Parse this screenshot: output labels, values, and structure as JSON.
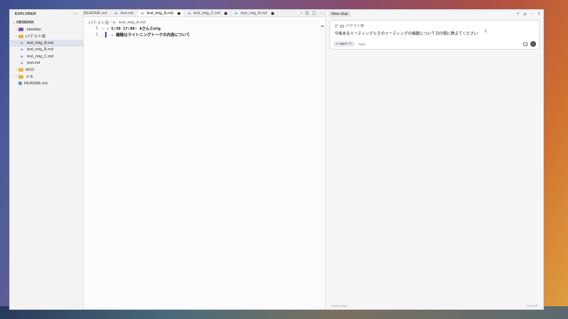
{
  "sidebar": {
    "title": "EXPLORER",
    "more": "···",
    "section": "OBSIDIAN",
    "items": [
      {
        "label": ".obsidian",
        "kind": "folder",
        "indent": 1,
        "chevron": "›",
        "color": "#7b4fc7"
      },
      {
        "label": "LTテスト用",
        "kind": "folder-open",
        "indent": 1,
        "chevron": "⌄",
        "color": "#e3b341"
      },
      {
        "label": "test_mtg_A.md",
        "kind": "md",
        "indent": 2,
        "selected": true
      },
      {
        "label": "test_mtg_B.md",
        "kind": "md",
        "indent": 2
      },
      {
        "label": "test_mtg_C.md",
        "kind": "md",
        "indent": 2
      },
      {
        "label": "test.md",
        "kind": "md",
        "indent": 2
      },
      {
        "label": "MOC",
        "kind": "folder",
        "indent": 1,
        "chevron": "›",
        "color": "#e3b341"
      },
      {
        "label": "メモ",
        "kind": "folder",
        "indent": 1,
        "chevron": "›",
        "color": "#e3b341"
      },
      {
        "label": "README.md",
        "kind": "info",
        "indent": 1
      }
    ]
  },
  "editor": {
    "tabs": [
      {
        "label": "README.md",
        "icon": "",
        "active": false,
        "dirty": false
      },
      {
        "label": "test.md",
        "icon": "M↓",
        "active": false,
        "dirty": false
      },
      {
        "label": "test_mtg_A.md",
        "icon": "M↓",
        "active": true,
        "dirty": true
      },
      {
        "label": "test_mtg_C.md",
        "icon": "M↓",
        "active": false,
        "dirty": true
      },
      {
        "label": "test_mtg_B.md",
        "icon": "M↓",
        "active": false,
        "dirty": true
      }
    ],
    "tab_overflow": "›",
    "breadcrumb": [
      "LTテスト用",
      "test_mtg_A.md"
    ],
    "lines": [
      {
        "num": "1",
        "text": "- 5/30 17:00~ Aさんとmtg",
        "fold": "⌄"
      },
      {
        "num": "2",
        "text": "  - 議題はライトニングトークの内容について",
        "fold": ""
      }
    ]
  },
  "chat": {
    "tab_label": "New chat",
    "context_label": "LTテスト用",
    "prompt": "今後あるミーティングとそのミーティングの議題について日付順に教えてください",
    "mode": "Agent",
    "mode_shortcut": "⌘I",
    "model": "Auto",
    "footer_left": "Past chats",
    "footer_right": "View all"
  }
}
